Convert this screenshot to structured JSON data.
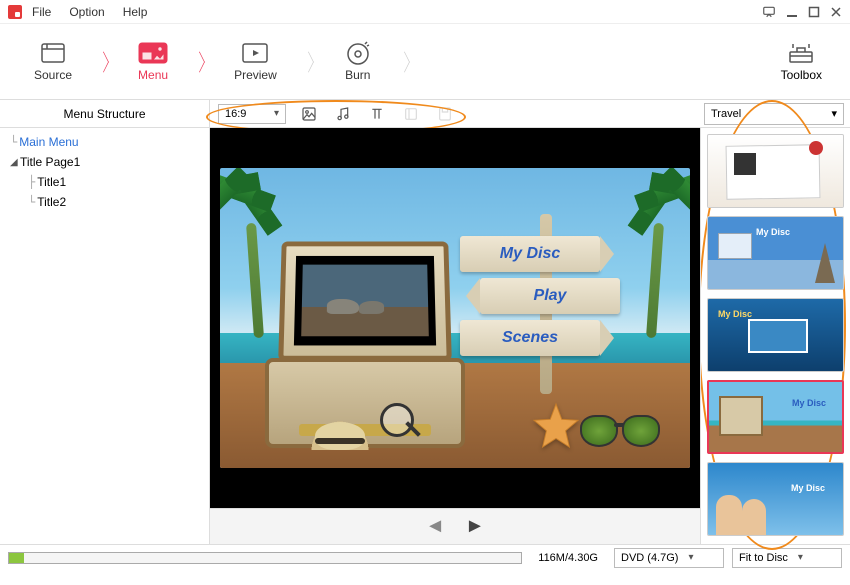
{
  "menubar": {
    "file": "File",
    "option": "Option",
    "help": "Help"
  },
  "flow": {
    "source": "Source",
    "menu": "Menu",
    "preview": "Preview",
    "burn": "Burn",
    "toolbox": "Toolbox"
  },
  "subbar": {
    "structure_label": "Menu Structure",
    "aspect": "16:9",
    "category": "Travel"
  },
  "tree": {
    "main_menu": "Main Menu",
    "title_page": "Title Page1",
    "title1": "Title1",
    "title2": "Title2"
  },
  "dvd_menu": {
    "disc": "My Disc",
    "play": "Play",
    "scenes": "Scenes"
  },
  "templates_mini_label": "My Disc",
  "status": {
    "size": "116M/4.30G",
    "disc_type": "DVD (4.7G)",
    "fit": "Fit to Disc"
  }
}
